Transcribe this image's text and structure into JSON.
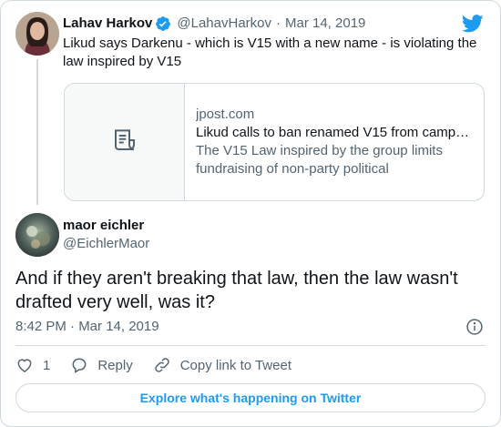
{
  "colors": {
    "link_blue": "#1d9bf0",
    "muted": "#536471",
    "border": "#cfd9de",
    "text": "#0f1419"
  },
  "parent_tweet": {
    "author_name": "Lahav Harkov",
    "author_handle": "@LahavHarkov",
    "separator": "·",
    "date": "Mar 14, 2019",
    "verified": true,
    "text": "Likud says Darkenu - which is V15 with a new name - is violating the law inspired by V15",
    "link_card": {
      "icon": "article-icon",
      "domain": "jpost.com",
      "title": "Likud calls to ban renamed V15 from camp…",
      "description": "The V15 Law inspired by the group limits fundraising of non-party political organizatio…"
    }
  },
  "main_tweet": {
    "author_name": "maor eichler",
    "author_handle": "@EichlerMaor",
    "text": "And if they aren't breaking that law, then the law wasn't drafted very well, was it?",
    "timestamp": "8:42 PM · Mar 14, 2019"
  },
  "actions": {
    "like_count": "1",
    "reply_label": "Reply",
    "copy_link_label": "Copy link to Tweet"
  },
  "explore_label": "Explore what's happening on Twitter",
  "icons": [
    "twitter-logo-icon",
    "verified-badge-icon",
    "article-icon",
    "info-icon",
    "heart-icon",
    "reply-icon",
    "link-icon"
  ]
}
